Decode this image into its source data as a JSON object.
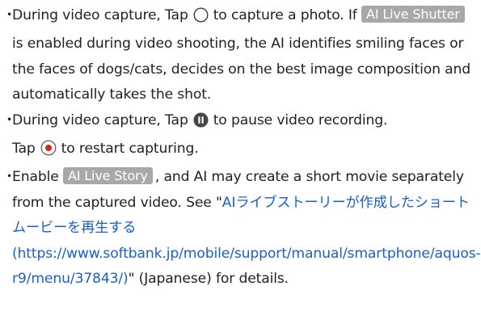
{
  "colors": {
    "text": "#222222",
    "link": "#1a5fcc",
    "tag_bg": "#a8a8a8",
    "rec_red": "#e0201b"
  },
  "bullet_mark": "・",
  "item1": {
    "text_a": "During video capture, Tap",
    "icon": "shutter-circle-icon",
    "text_b": "to capture a photo. If",
    "tag": "AI Live Shutter",
    "text_c": "is enabled during video shooting, the AI identifies smiling faces or the faces of dogs/cats, decides on the best image composition and automatically takes the shot."
  },
  "item2": {
    "text_a": "During video capture, Tap",
    "icon_pause": "pause-icon",
    "text_b": "to pause video recording.",
    "text_c": "Tap",
    "icon_record": "record-icon",
    "text_d": "to restart capturing."
  },
  "item3": {
    "text_a": "Enable",
    "tag": "AI Live Story",
    "text_b": ", and AI may create a short movie separately from the captured video. See \"",
    "link": "AIライブストーリーが作成したショートムービーを再生する (https://www.softbank.jp/mobile/support/manual/smartphone/aquos-r9/menu/37843/)",
    "text_c": "\" (Japanese) for details."
  }
}
